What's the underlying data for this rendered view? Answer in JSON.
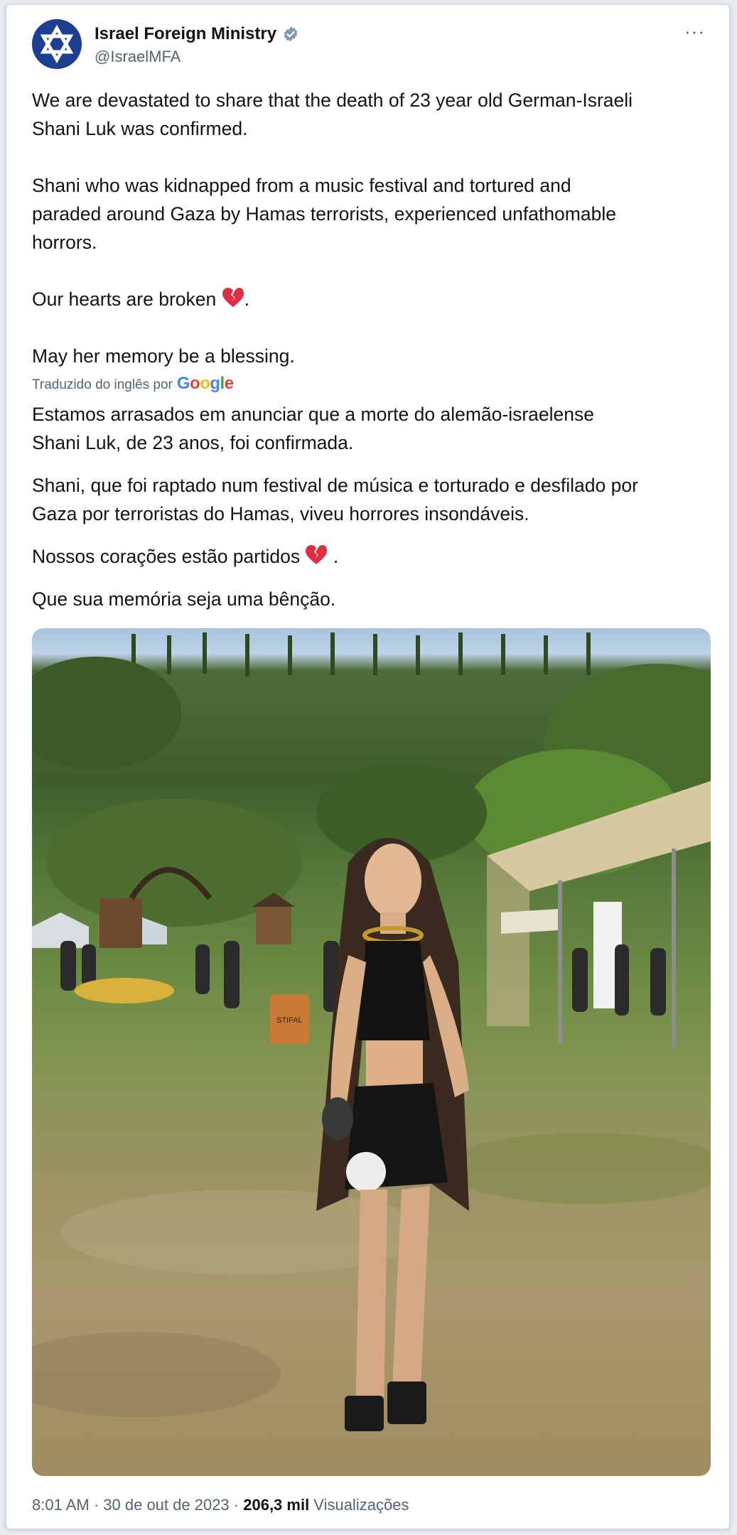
{
  "account": {
    "name": "Israel Foreign Ministry",
    "handle": "@IsraelMFA",
    "avatar_icon": "star-of-david-logo-icon",
    "verified_icon": "verified-badge-icon",
    "more_icon": "more-options-icon",
    "more_label": "···"
  },
  "tweet": {
    "para1": "We are devastated to share that the death of 23 year old German-Israeli\nShani Luk was confirmed.",
    "para2": "Shani who was kidnapped from a music festival and tortured and\nparaded around Gaza by Hamas terrorists, experienced unfathomable\nhorrors.",
    "para3": "Our hearts are broken",
    "para3_end": ".",
    "para4": "May her memory be a blessing."
  },
  "translation": {
    "label": "Traduzido do inglês por",
    "provider": "Google",
    "para1": "Estamos arrasados em anunciar que a morte do alemão-israelense\nShani Luk, de 23 anos, foi confirmada.",
    "para2": "Shani, que foi raptado num festival de música e torturado e desfilado por\nGaza por terroristas do Hamas, viveu horrores insondáveis.",
    "para3": "Nossos corações estão partidos",
    "para3_end": " .",
    "para4": "Que sua memória seja uma bênção."
  },
  "media": {
    "barrel_text": "STIFAL"
  },
  "meta": {
    "time": "8:01 AM",
    "separator": " · ",
    "date": "30 de out de 2023",
    "views_count": "206,3 mil",
    "views_label": " Visualizações"
  },
  "colors": {
    "text": "#0f1419",
    "secondary": "#536471",
    "verified": "#829aab",
    "avatar_bg": "#1d3f8f",
    "broken_heart": "#dd2e44"
  }
}
